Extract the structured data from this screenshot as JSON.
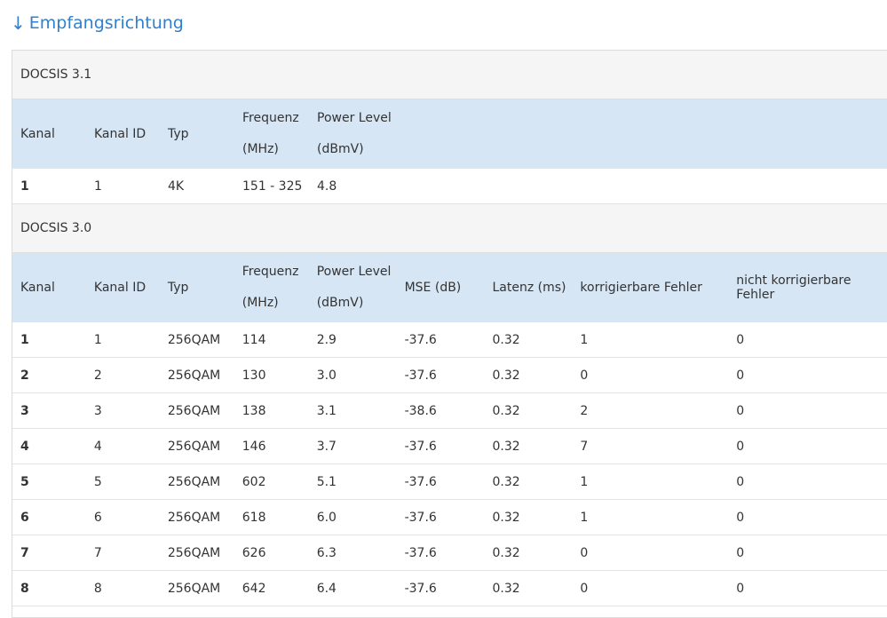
{
  "page": {
    "title": "Empfangsrichtung"
  },
  "docsis31": {
    "label": "DOCSIS 3.1",
    "headers": {
      "kanal": "Kanal",
      "kanal_id": "Kanal ID",
      "typ": "Typ",
      "frequenz_line1": "Frequenz",
      "frequenz_line2": "(MHz)",
      "power_line1": "Power Level",
      "power_line2": "(dBmV)"
    },
    "rows": [
      {
        "kanal": "1",
        "kanal_id": "1",
        "typ": "4K",
        "frequenz": "151 - 325",
        "power": "4.8"
      }
    ]
  },
  "docsis30": {
    "label": "DOCSIS 3.0",
    "headers": {
      "kanal": "Kanal",
      "kanal_id": "Kanal ID",
      "typ": "Typ",
      "frequenz_line1": "Frequenz",
      "frequenz_line2": "(MHz)",
      "power_line1": "Power Level",
      "power_line2": "(dBmV)",
      "mse": "MSE (dB)",
      "latenz": "Latenz (ms)",
      "korrigierbar": "korrigierbare Fehler",
      "nicht_korrigierbar": "nicht korrigierbare Fehler"
    },
    "rows": [
      {
        "kanal": "1",
        "kanal_id": "1",
        "typ": "256QAM",
        "frequenz": "114",
        "power": "2.9",
        "mse": "-37.6",
        "latenz": "0.32",
        "korr": "1",
        "nkorr": "0"
      },
      {
        "kanal": "2",
        "kanal_id": "2",
        "typ": "256QAM",
        "frequenz": "130",
        "power": "3.0",
        "mse": "-37.6",
        "latenz": "0.32",
        "korr": "0",
        "nkorr": "0"
      },
      {
        "kanal": "3",
        "kanal_id": "3",
        "typ": "256QAM",
        "frequenz": "138",
        "power": "3.1",
        "mse": "-38.6",
        "latenz": "0.32",
        "korr": "2",
        "nkorr": "0"
      },
      {
        "kanal": "4",
        "kanal_id": "4",
        "typ": "256QAM",
        "frequenz": "146",
        "power": "3.7",
        "mse": "-37.6",
        "latenz": "0.32",
        "korr": "7",
        "nkorr": "0"
      },
      {
        "kanal": "5",
        "kanal_id": "5",
        "typ": "256QAM",
        "frequenz": "602",
        "power": "5.1",
        "mse": "-37.6",
        "latenz": "0.32",
        "korr": "1",
        "nkorr": "0"
      },
      {
        "kanal": "6",
        "kanal_id": "6",
        "typ": "256QAM",
        "frequenz": "618",
        "power": "6.0",
        "mse": "-37.6",
        "latenz": "0.32",
        "korr": "1",
        "nkorr": "0"
      },
      {
        "kanal": "7",
        "kanal_id": "7",
        "typ": "256QAM",
        "frequenz": "626",
        "power": "6.3",
        "mse": "-37.6",
        "latenz": "0.32",
        "korr": "0",
        "nkorr": "0"
      },
      {
        "kanal": "8",
        "kanal_id": "8",
        "typ": "256QAM",
        "frequenz": "642",
        "power": "6.4",
        "mse": "-37.6",
        "latenz": "0.32",
        "korr": "0",
        "nkorr": "0"
      }
    ]
  }
}
